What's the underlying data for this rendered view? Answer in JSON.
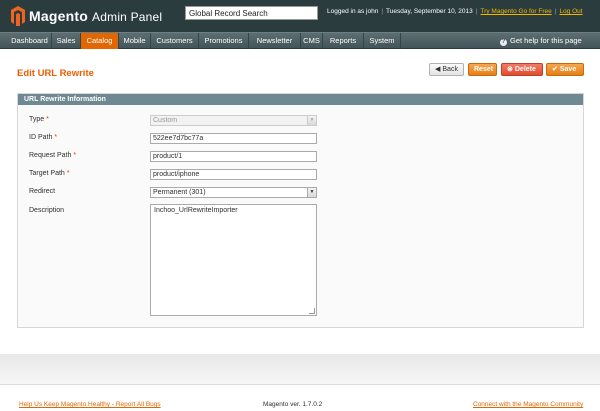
{
  "header": {
    "brand": "Magento",
    "brand_suffix": "Admin Panel",
    "search_value": "Global Record Search",
    "logged_in": "Logged in as john",
    "date": "Tuesday, September 10, 2013",
    "try_link": "Try Magento Go for Free",
    "logout": "Log Out"
  },
  "nav": {
    "items": [
      "Dashboard",
      "Sales",
      "Catalog",
      "Mobile",
      "Customers",
      "Promotions",
      "Newsletter",
      "CMS",
      "Reports",
      "System"
    ],
    "active": "Catalog",
    "help": "Get help for this page"
  },
  "page": {
    "title": "Edit URL Rewrite",
    "buttons": {
      "back": "Back",
      "reset": "Reset",
      "delete": "Delete",
      "save": "Save"
    }
  },
  "form": {
    "section_title": "URL Rewrite Information",
    "fields": {
      "type": {
        "label": "Type",
        "required": "*",
        "value": "Custom"
      },
      "id_path": {
        "label": "ID Path",
        "required": "*",
        "value": "522ee7d7bc77a"
      },
      "request_path": {
        "label": "Request Path",
        "required": "*",
        "value": "product/1"
      },
      "target_path": {
        "label": "Target Path",
        "required": "*",
        "value": "product/iphone"
      },
      "redirect": {
        "label": "Redirect",
        "value": "Permanent (301)"
      },
      "description": {
        "label": "Description",
        "value": "Inchoo_UrlRewriteImporter"
      }
    }
  },
  "footer": {
    "left_link": "Help Us Keep Magento Healthy - Report All Bugs",
    "version": "Magento ver. 1.7.0.2",
    "right_link": "Connect with the Magento Community"
  },
  "colors": {
    "accent": "#e26703",
    "header_bg": "#2b3c3f",
    "section_head": "#6f8992",
    "title": "#eb5e00"
  }
}
